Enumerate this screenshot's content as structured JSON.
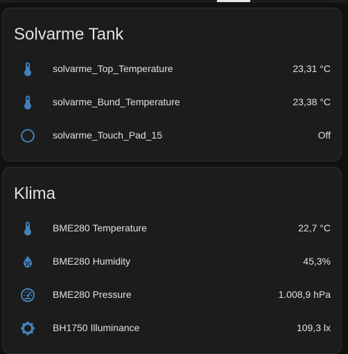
{
  "colors": {
    "icon": "#4480b8",
    "card_bg": "#1c1c1c",
    "page_bg": "#111111",
    "text": "#e1e1e1"
  },
  "cards": [
    {
      "title": "Solvarme Tank",
      "rows": [
        {
          "icon": "thermometer-icon",
          "label": "solvarme_Top_Temperature",
          "value": "23,31 °C"
        },
        {
          "icon": "thermometer-icon",
          "label": "solvarme_Bund_Temperature",
          "value": "23,38 °C"
        },
        {
          "icon": "circle-outline-icon",
          "label": "solvarme_Touch_Pad_15",
          "value": "Off"
        }
      ]
    },
    {
      "title": "Klima",
      "rows": [
        {
          "icon": "thermometer-icon",
          "label": "BME280 Temperature",
          "value": "22,7 °C"
        },
        {
          "icon": "water-percent-icon",
          "label": "BME280 Humidity",
          "value": "45,3%"
        },
        {
          "icon": "gauge-icon",
          "label": "BME280 Pressure",
          "value": "1.008,9 hPa"
        },
        {
          "icon": "brightness-icon",
          "label": "BH1750 Illuminance",
          "value": "109,3 lx"
        }
      ]
    }
  ]
}
